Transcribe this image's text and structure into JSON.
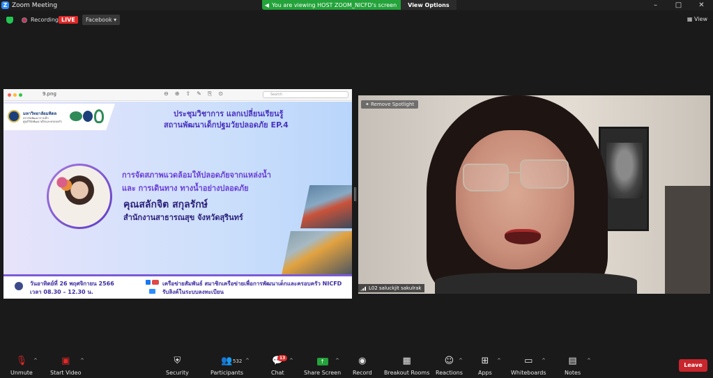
{
  "window": {
    "title": "Zoom Meeting",
    "minimize": "–",
    "maximize": "□",
    "close": "✕",
    "logo_letter": "Z"
  },
  "banner": {
    "text": "You are viewing HOST ZOOM_NICFD's screen",
    "view_options": "View Options"
  },
  "topbar": {
    "recording": "Recording",
    "live": "LIVE",
    "facebook": "Facebook ▾",
    "view": "View"
  },
  "viewer": {
    "file": "9.png",
    "search_placeholder": "Search"
  },
  "slide": {
    "logo_org": "มหาวิทยาลัยมหิดล",
    "logo_sub1": "สถาบันพัฒนาการเด็ก",
    "logo_sub2": "ศูนย์วิจัยพัฒนาเด็กและครอบครัว",
    "title_line1": "ประชุมวิชาการ แลกเปลี่ยนเรียนรู้",
    "title_line2": "สถานพัฒนาเด็กปฐมวัยปลอดภัย EP.4",
    "topic_line1": "การจัดสภาพแวดล้อมให้ปลอดภัยจากแหล่งน้ำ",
    "topic_line2": "และ การเดินทาง ทางน้ำอย่างปลอดภัย",
    "speaker": "คุณสลักจิต สกุลรักษ์",
    "speaker_org": "สำนักงานสาธารณสุข จังหวัดสุรินทร์",
    "date": "วันอาทิตย์ที่ 26 พฤศจิกายน 2566",
    "time": "เวลา 08.30 – 12.30 น.",
    "network": "เครือข่ายสัมพันธ์ สมาชิกเครือข่ายเพื่อการพัฒนาเด็กและครอบครัว NICFD",
    "zoom_note": "รับลิงค์ในระบบลงทะเบียน"
  },
  "video": {
    "remove_spotlight": "Remove Spotlight",
    "participant_name": "L02 saluckjit sakulrak"
  },
  "toolbar": {
    "unmute": "Unmute",
    "start_video": "Start Video",
    "security": "Security",
    "participants": "Participants",
    "participant_count": "532",
    "chat": "Chat",
    "chat_badge": "13",
    "share_screen": "Share Screen",
    "record": "Record",
    "breakout": "Breakout Rooms",
    "reactions": "Reactions",
    "apps": "Apps",
    "whiteboards": "Whiteboards",
    "notes": "Notes",
    "leave": "Leave"
  },
  "colors": {
    "accent": "#2d8cff",
    "share_green": "#23a33a",
    "leave_red": "#c8252c",
    "live_red": "#e02828"
  }
}
